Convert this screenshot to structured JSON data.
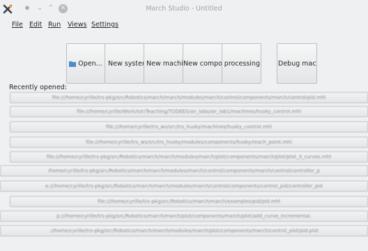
{
  "window": {
    "title": "March Studio - Untitled",
    "controls": [
      "keep-above",
      "minimize",
      "maximize",
      "close"
    ]
  },
  "menu": [
    "File",
    "Edit",
    "Run",
    "Views",
    "Settings"
  ],
  "toolbar": {
    "buttons": [
      {
        "label": "Open...",
        "icon": "folder-icon"
      },
      {
        "label": "New system",
        "icon": "new-item-icon"
      },
      {
        "label": "New machine",
        "icon": "new-item-icon"
      },
      {
        "label": "New component",
        "icon": ""
      },
      {
        "label": "New processing",
        "icon": ""
      },
      {
        "label": "Debug machine",
        "icon": ""
      }
    ]
  },
  "recent": {
    "label": "Recently opened:",
    "items": [
      "file:///home/cyrille/trs-pkg/src/Robotics/march/march/modules/march/control/components/march/control/pid.mhl",
      "file:///home/cyrille/Work/Isir/Teaching/TODEES/air_labs/air_lab1/machines/husky_control.mhl",
      "file:///home/cyrille/trs_ws/src/trs_husky/machines/husky_control.mhl",
      "file:///home/cyrille/trs_ws/src/trs_husky/modules/components/husky/reach_point.mhl",
      "file:///home/cyrille/trs-pkg/src/Robotics/march/march/modules/march/plot/components/march/plot/plot_3_curves.mhl",
      "/home/cyrille/trs-pkg/src/Robotics/march/march/modules/march/control/components/march/control/controller_p",
      "e:///home/cyrille/trs-pkg/src/Robotics/march/march/modules/march/control/components/control_pid/controller_pid",
      "file:///home/cyrille/trs-pkg/src/Robotics/march/march/examples/pid/pid.mhl",
      "p:///home/cyrille/trs-pkg/src/Robotics/march/march/plot/components/march/plot/add_curve_incremental.",
      "://home/cyrille/trs-pkg/src/Robotics/march/march/modules/march/plot/components/march/control_plot/pid.plot"
    ]
  }
}
